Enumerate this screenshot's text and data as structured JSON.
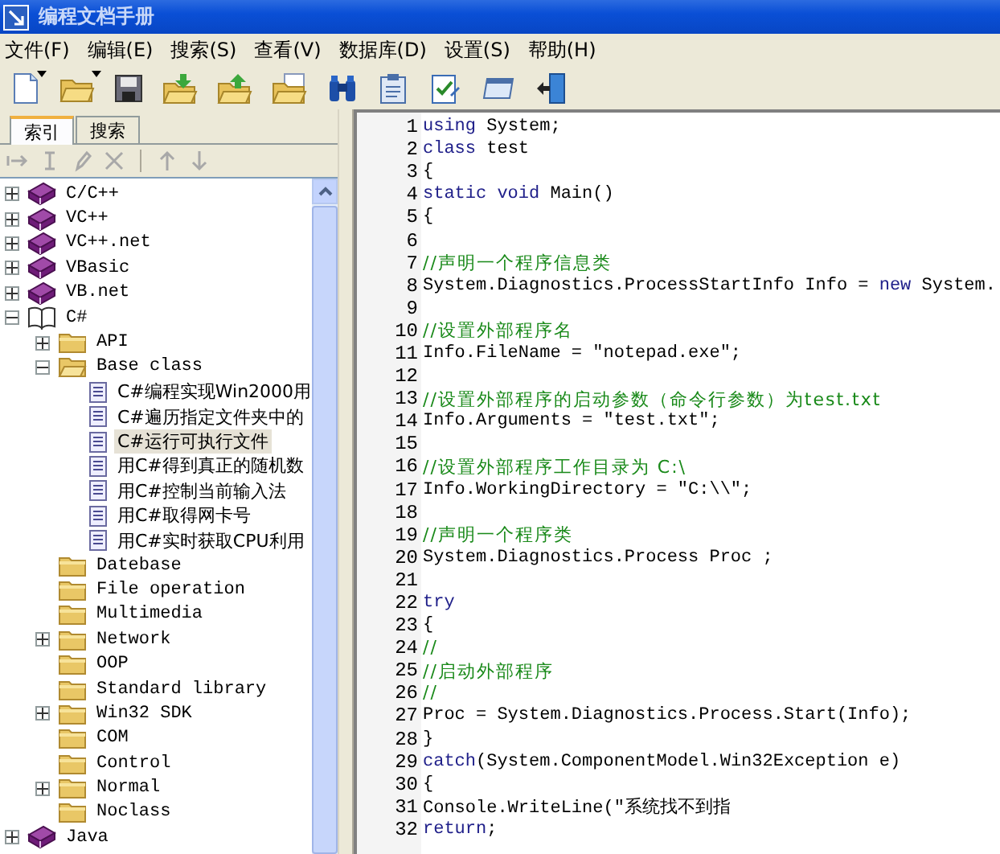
{
  "window": {
    "title": "编程文档手册"
  },
  "menu": [
    {
      "label": "文件(F)"
    },
    {
      "label": "编辑(E)"
    },
    {
      "label": "搜索(S)"
    },
    {
      "label": "查看(V)"
    },
    {
      "label": "数据库(D)"
    },
    {
      "label": "设置(S)"
    },
    {
      "label": "帮助(H)"
    }
  ],
  "toolbar": [
    {
      "kind": "new",
      "dropdown": true
    },
    {
      "kind": "open",
      "dropdown": true
    },
    {
      "kind": "save"
    },
    {
      "kind": "import"
    },
    {
      "kind": "export"
    },
    {
      "kind": "folder-edit"
    },
    {
      "kind": "find"
    },
    {
      "kind": "notes"
    },
    {
      "kind": "check"
    },
    {
      "kind": "window"
    },
    {
      "kind": "exit"
    }
  ],
  "side_tabs": [
    {
      "label": "索引",
      "selected": true
    },
    {
      "label": "搜索",
      "selected": false
    }
  ],
  "side_tools": [
    {
      "kind": "indent",
      "disabled": true
    },
    {
      "kind": "insert",
      "disabled": true
    },
    {
      "kind": "edit",
      "disabled": true
    },
    {
      "kind": "delete",
      "disabled": true
    },
    {
      "kind": "up",
      "disabled": true
    },
    {
      "kind": "down",
      "disabled": true
    }
  ],
  "tree": [
    {
      "kind": "book",
      "label": "C/C++",
      "expanded": false,
      "selected": false
    },
    {
      "kind": "book",
      "label": "VC++",
      "expanded": false,
      "selected": false
    },
    {
      "kind": "book",
      "label": "VC++.net",
      "expanded": false,
      "selected": false
    },
    {
      "kind": "book",
      "label": "VBasic",
      "expanded": false,
      "selected": false
    },
    {
      "kind": "book",
      "label": "VB.net",
      "expanded": false,
      "selected": false
    },
    {
      "kind": "book",
      "label": "C#",
      "expanded": true,
      "selected": false,
      "children": [
        {
          "kind": "folder",
          "label": "API",
          "expanded": false,
          "selected": false
        },
        {
          "kind": "folder",
          "label": "Base class",
          "expanded": true,
          "selected": false,
          "children": [
            {
              "kind": "doc",
              "label": "C#编程实现Win2000用",
              "selected": false
            },
            {
              "kind": "doc",
              "label": "C#遍历指定文件夹中的",
              "selected": false
            },
            {
              "kind": "doc",
              "label": "C#运行可执行文件",
              "selected": true
            },
            {
              "kind": "doc",
              "label": "用C#得到真正的随机数",
              "selected": false
            },
            {
              "kind": "doc",
              "label": "用C#控制当前输入法",
              "selected": false
            },
            {
              "kind": "doc",
              "label": "用C#取得网卡号",
              "selected": false
            },
            {
              "kind": "doc",
              "label": "用C#实时获取CPU利用",
              "selected": false
            }
          ]
        },
        {
          "kind": "folder",
          "label": "Datebase",
          "selected": false
        },
        {
          "kind": "folder",
          "label": "File operation",
          "selected": false
        },
        {
          "kind": "folder",
          "label": "Multimedia",
          "selected": false
        },
        {
          "kind": "folder",
          "label": "Network",
          "expanded": false,
          "selected": false
        },
        {
          "kind": "folder",
          "label": "OOP",
          "selected": false
        },
        {
          "kind": "folder",
          "label": "Standard library",
          "selected": false
        },
        {
          "kind": "folder",
          "label": "Win32 SDK",
          "expanded": false,
          "selected": false
        },
        {
          "kind": "folder",
          "label": "COM",
          "selected": false
        },
        {
          "kind": "folder",
          "label": "Control",
          "selected": false
        },
        {
          "kind": "folder",
          "label": "Normal",
          "expanded": false,
          "selected": false
        },
        {
          "kind": "folder",
          "label": "Noclass",
          "selected": false
        }
      ]
    },
    {
      "kind": "book",
      "label": "Java",
      "expanded": false,
      "selected": false
    }
  ],
  "code": [
    {
      "n": "1",
      "parts": [
        {
          "kind": "keyword",
          "text": "using"
        },
        {
          "kind": "plain",
          "text": " System;"
        }
      ]
    },
    {
      "n": "2",
      "parts": [
        {
          "kind": "keyword",
          "text": "class"
        },
        {
          "kind": "plain",
          "text": " test"
        }
      ]
    },
    {
      "n": "3",
      "parts": [
        {
          "kind": "plain",
          "text": "{"
        }
      ]
    },
    {
      "n": "4",
      "parts": [
        {
          "kind": "keyword",
          "text": "static void"
        },
        {
          "kind": "plain",
          "text": " Main()"
        }
      ]
    },
    {
      "n": "5",
      "parts": [
        {
          "kind": "plain",
          "text": "{"
        }
      ]
    },
    {
      "n": "6"
    },
    {
      "n": "7",
      "parts": [
        {
          "kind": "comment",
          "text": "//声明一个程序信息类"
        }
      ]
    },
    {
      "n": "8",
      "parts": [
        {
          "kind": "plain",
          "text": "System.Diagnostics.ProcessStartInfo Info = "
        },
        {
          "kind": "keyword",
          "text": "new"
        },
        {
          "kind": "plain",
          "text": " System."
        }
      ]
    },
    {
      "n": "9"
    },
    {
      "n": "10",
      "parts": [
        {
          "kind": "comment",
          "text": "//设置外部程序名"
        }
      ]
    },
    {
      "n": "11",
      "parts": [
        {
          "kind": "plain",
          "text": "Info.FileName = \"notepad.exe\";"
        }
      ]
    },
    {
      "n": "12"
    },
    {
      "n": "13",
      "parts": [
        {
          "kind": "comment",
          "text": "//设置外部程序的启动参数（命令行参数）为test.txt"
        }
      ]
    },
    {
      "n": "14",
      "parts": [
        {
          "kind": "plain",
          "text": "Info.Arguments = \"test.txt\";"
        }
      ]
    },
    {
      "n": "15"
    },
    {
      "n": "16",
      "parts": [
        {
          "kind": "comment",
          "text": "//设置外部程序工作目录为 C:\\"
        }
      ]
    },
    {
      "n": "17",
      "parts": [
        {
          "kind": "plain",
          "text": "Info.WorkingDirectory = \"C:\\\\\";"
        }
      ]
    },
    {
      "n": "18"
    },
    {
      "n": "19",
      "parts": [
        {
          "kind": "comment",
          "text": "//声明一个程序类"
        }
      ]
    },
    {
      "n": "20",
      "parts": [
        {
          "kind": "plain",
          "text": "System.Diagnostics.Process Proc ;"
        }
      ]
    },
    {
      "n": "21"
    },
    {
      "n": "22",
      "parts": [
        {
          "kind": "keyword",
          "text": "try"
        }
      ]
    },
    {
      "n": "23",
      "parts": [
        {
          "kind": "plain",
          "text": "{"
        }
      ]
    },
    {
      "n": "24",
      "parts": [
        {
          "kind": "comment",
          "text": "//"
        }
      ]
    },
    {
      "n": "25",
      "parts": [
        {
          "kind": "comment",
          "text": "//启动外部程序"
        }
      ]
    },
    {
      "n": "26",
      "parts": [
        {
          "kind": "comment",
          "text": "//"
        }
      ]
    },
    {
      "n": "27",
      "parts": [
        {
          "kind": "plain",
          "text": "Proc = System.Diagnostics.Process.Start(Info);"
        }
      ]
    },
    {
      "n": "28",
      "parts": [
        {
          "kind": "plain",
          "text": "}"
        }
      ]
    },
    {
      "n": "29",
      "parts": [
        {
          "kind": "keyword",
          "text": "catch"
        },
        {
          "kind": "plain",
          "text": "(System.ComponentModel.Win32Exception e)"
        }
      ]
    },
    {
      "n": "30",
      "parts": [
        {
          "kind": "plain",
          "text": "{"
        }
      ]
    },
    {
      "n": "31",
      "parts": [
        {
          "kind": "plain",
          "text": "Console.WriteLine(\"系统找不到指"
        }
      ]
    },
    {
      "n": "32",
      "parts": [
        {
          "kind": "keyword",
          "text": "return"
        },
        {
          "kind": "plain",
          "text": ";"
        }
      ]
    }
  ]
}
